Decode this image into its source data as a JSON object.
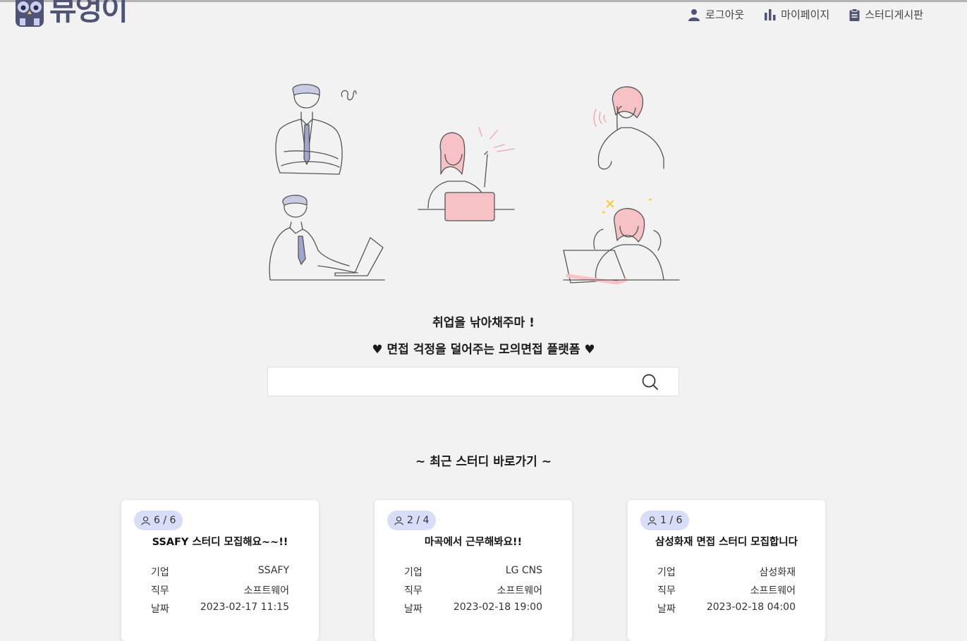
{
  "brand": {
    "name": "뷰엉이"
  },
  "nav": [
    {
      "label": "로그아웃",
      "icon": "user-icon"
    },
    {
      "label": "마이페이지",
      "icon": "bar-chart-icon"
    },
    {
      "label": "스터디게시판",
      "icon": "clipboard-icon"
    }
  ],
  "hero": {
    "tagline": "취업을 낚아채주마 !",
    "subline": "♥ 면접 걱정을 덜어주는 모의면접 플랫폼 ♥"
  },
  "search": {
    "value": "",
    "placeholder": ""
  },
  "recent": {
    "title": "~ 최근 스터디 바로가기 ~"
  },
  "field_labels": {
    "company": "기업",
    "job": "직무",
    "date": "날짜"
  },
  "cards": [
    {
      "members": "6 / 6",
      "title": "SSAFY 스터디 모집해요~~!!",
      "company": "SSAFY",
      "job": "소프트웨어",
      "date": "2023-02-17 11:15"
    },
    {
      "members": "2 / 4",
      "title": "마곡에서 근무해봐요!!",
      "company": "LG CNS",
      "job": "소프트웨어",
      "date": "2023-02-18 19:00"
    },
    {
      "members": "1 / 6",
      "title": "삼성화재 면접 스터디 모집합니다",
      "company": "삼성화재",
      "job": "소프트웨어",
      "date": "2023-02-18 04:00"
    }
  ],
  "colors": {
    "brand": "#4f5374",
    "badge": "#d8ddf8",
    "accent_pink": "#f7c2c5"
  }
}
